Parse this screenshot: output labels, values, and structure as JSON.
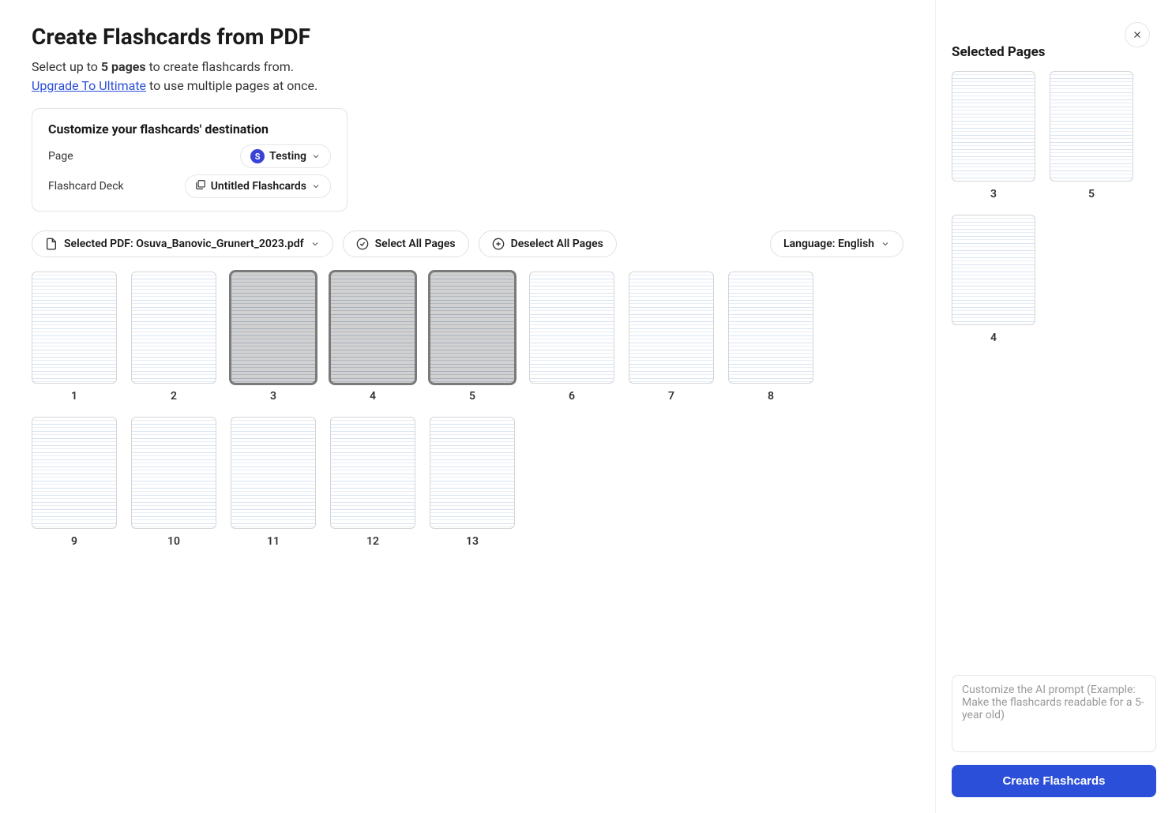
{
  "header": {
    "title": "Create Flashcards from PDF",
    "subtitle_prefix": "Select up to ",
    "subtitle_bold": "5 pages",
    "subtitle_suffix": " to create flashcards from.",
    "upgrade_link_text": "Upgrade To Ultimate",
    "upgrade_suffix": " to use multiple pages at once."
  },
  "destination": {
    "title": "Customize your flashcards' destination",
    "page_label": "Page",
    "page_value": "Testing",
    "deck_label": "Flashcard Deck",
    "deck_value": "Untitled Flashcards"
  },
  "toolbar": {
    "selected_pdf_prefix": "Selected PDF: ",
    "selected_pdf_name": "Osuva_Banovic_Grunert_2023.pdf",
    "select_all": "Select All Pages",
    "deselect_all": "Deselect All Pages",
    "language_label": "Language: English"
  },
  "pages": [
    {
      "num": "1",
      "selected": false
    },
    {
      "num": "2",
      "selected": false
    },
    {
      "num": "3",
      "selected": true
    },
    {
      "num": "4",
      "selected": true
    },
    {
      "num": "5",
      "selected": true
    },
    {
      "num": "6",
      "selected": false
    },
    {
      "num": "7",
      "selected": false
    },
    {
      "num": "8",
      "selected": false
    },
    {
      "num": "9",
      "selected": false
    },
    {
      "num": "10",
      "selected": false
    },
    {
      "num": "11",
      "selected": false
    },
    {
      "num": "12",
      "selected": false
    },
    {
      "num": "13",
      "selected": false
    }
  ],
  "selected_panel": {
    "title": "Selected Pages",
    "pages": [
      {
        "num": "3"
      },
      {
        "num": "5"
      },
      {
        "num": "4"
      }
    ]
  },
  "prompt_placeholder": "Customize the AI prompt (Example: Make the flashcards readable for a 5-year old)",
  "create_button": "Create Flashcards"
}
